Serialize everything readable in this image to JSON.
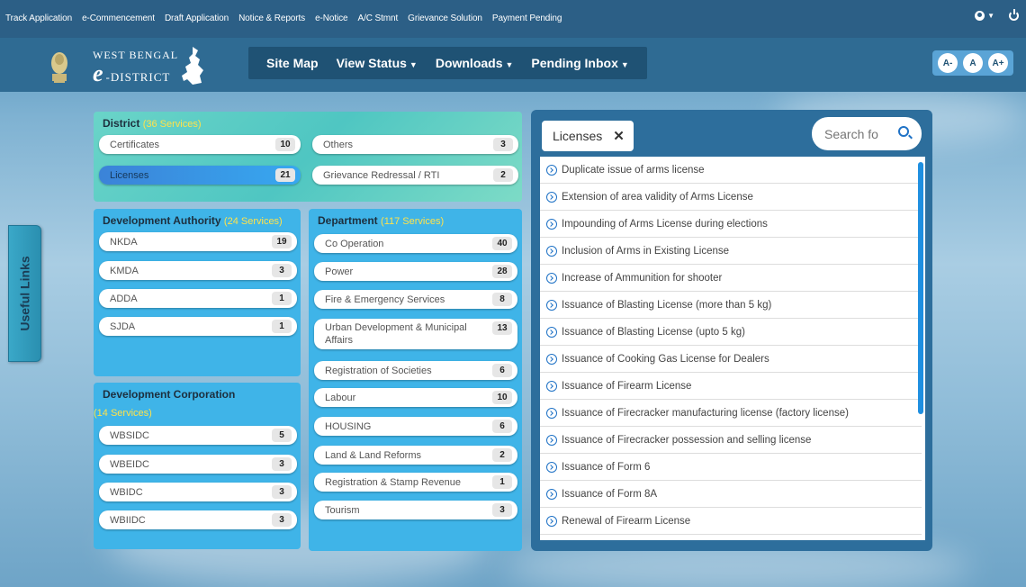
{
  "topbar": {
    "links": [
      "Track Application",
      "e-Commencement",
      "Draft Application",
      "Notice & Reports",
      "e-Notice",
      "A/C Stmnt",
      "Grievance Solution",
      "Payment Pending"
    ]
  },
  "header": {
    "logo_line1": "WEST BENGAL",
    "logo_e": "e",
    "logo_line2": "-DISTRICT",
    "nav": {
      "site_map": "Site Map",
      "view_status": "View Status",
      "downloads": "Downloads",
      "pending_inbox": "Pending Inbox"
    },
    "font_buttons": [
      "A-",
      "A",
      "A+"
    ]
  },
  "useful_links": "Useful Links",
  "district": {
    "title": "District",
    "count": "(36 Services)",
    "items": [
      {
        "label": "Certificates",
        "count": "10"
      },
      {
        "label": "Others",
        "count": "3"
      },
      {
        "label": "Licenses",
        "count": "21"
      },
      {
        "label": "Grievance Redressal / RTI",
        "count": "2"
      }
    ]
  },
  "dev_authority": {
    "title": "Development Authority",
    "count": "(24 Services)",
    "items": [
      {
        "label": "NKDA",
        "count": "19"
      },
      {
        "label": "KMDA",
        "count": "3"
      },
      {
        "label": "ADDA",
        "count": "1"
      },
      {
        "label": "SJDA",
        "count": "1"
      }
    ]
  },
  "department": {
    "title": "Department",
    "count": "(117 Services)",
    "items": [
      {
        "label": "Co Operation",
        "count": "40"
      },
      {
        "label": "Power",
        "count": "28"
      },
      {
        "label": "Fire & Emergency Services",
        "count": "8"
      },
      {
        "label": "Urban Development & Municipal Affairs",
        "count": "13"
      },
      {
        "label": "Registration of Societies",
        "count": "6"
      },
      {
        "label": "Labour",
        "count": "10"
      },
      {
        "label": "HOUSING",
        "count": "6"
      },
      {
        "label": "Land & Land Reforms",
        "count": "2"
      },
      {
        "label": "Registration & Stamp Revenue",
        "count": "1"
      },
      {
        "label": "Tourism",
        "count": "3"
      }
    ]
  },
  "dev_corporation": {
    "title": "Development Corporation",
    "count": "(14 Services)",
    "items": [
      {
        "label": "WBSIDC",
        "count": "5"
      },
      {
        "label": "WBEIDC",
        "count": "3"
      },
      {
        "label": "WBIDC",
        "count": "3"
      },
      {
        "label": "WBIIDC",
        "count": "3"
      }
    ]
  },
  "licenses_panel": {
    "chip_label": "Licenses",
    "close_symbol": "✕",
    "search_placeholder": "Search fo",
    "items": [
      "Duplicate issue of arms license",
      "Extension of area validity of Arms License",
      "Impounding of Arms License during elections",
      "Inclusion of Arms in Existing License",
      "Increase of Ammunition for shooter",
      "Issuance of Blasting License (more than 5 kg)",
      "Issuance of Blasting License (upto 5 kg)",
      "Issuance of Cooking Gas License for Dealers",
      "Issuance of Firearm License",
      "Issuance of Firecracker manufacturing license (factory license)",
      "Issuance of Firecracker possession and selling license",
      "Issuance of Form 6",
      "Issuance of Form 8A",
      "Renewal of Firearm License"
    ]
  }
}
